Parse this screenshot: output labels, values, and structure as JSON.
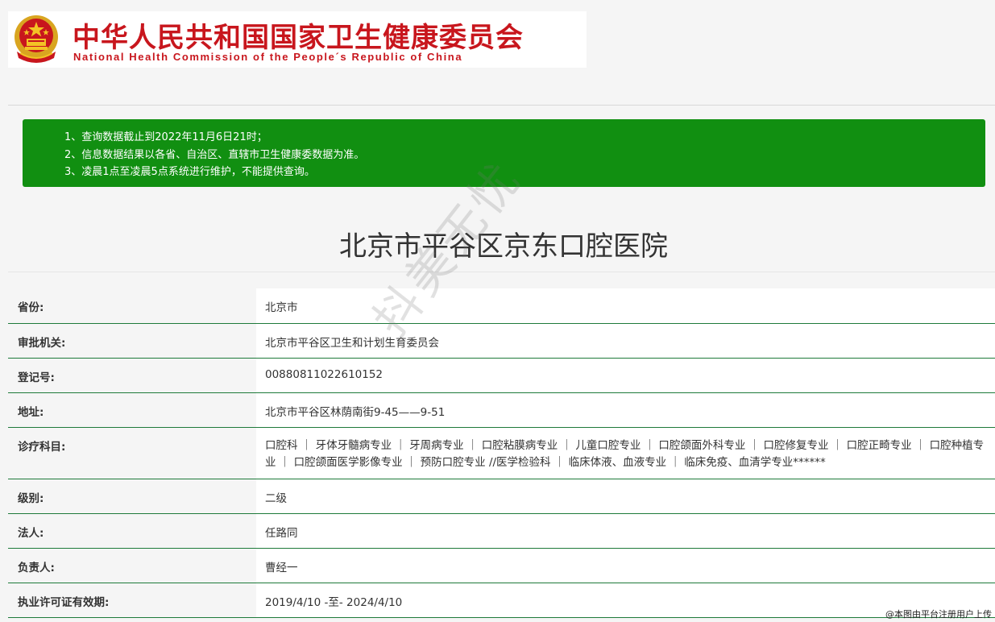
{
  "header": {
    "title_cn": "中华人民共和国国家卫生健康委员会",
    "title_en": "National Health Commission of the People´s Republic of China",
    "emblem_icon": "national-emblem-icon",
    "brand_color": "#c8161d"
  },
  "notice": {
    "background": "#118f11",
    "lines": [
      "1、查询数据截止到2022年11月6日21时；",
      "2、信息数据结果以各省、自治区、直辖市卫生健康委数据为准。",
      "3、凌晨1点至凌晨5点系统进行维护，不能提供查询。"
    ]
  },
  "page_title": "北京市平谷区京东口腔医院",
  "info": {
    "rows": [
      {
        "label": "省份:",
        "value": "北京市"
      },
      {
        "label": "审批机关:",
        "value": "北京市平谷区卫生和计划生育委员会"
      },
      {
        "label": "登记号:",
        "value": "00880811022610152"
      },
      {
        "label": "地址:",
        "value": "北京市平谷区林荫南街9-45——9-51"
      },
      {
        "label": "诊疗科目:",
        "value": "口腔科 ｜ 牙体牙髓病专业 ｜ 牙周病专业 ｜ 口腔粘膜病专业 ｜ 儿童口腔专业 ｜ 口腔颌面外科专业 ｜ 口腔修复专业 ｜ 口腔正畸专业 ｜ 口腔种植专业 ｜ 口腔颌面医学影像专业 ｜ 预防口腔专业 //医学检验科 ｜ 临床体液、血液专业 ｜ 临床免疫、血清学专业******"
      },
      {
        "label": "级别:",
        "value": "二级"
      },
      {
        "label": "法人:",
        "value": "任路同"
      },
      {
        "label": "负责人:",
        "value": "曹经一"
      },
      {
        "label": "执业许可证有效期:",
        "value": "2019/4/10 -至- 2024/4/10"
      }
    ]
  },
  "watermark": "抖美无忧",
  "footer_note": "@本图由平台注册用户上传"
}
